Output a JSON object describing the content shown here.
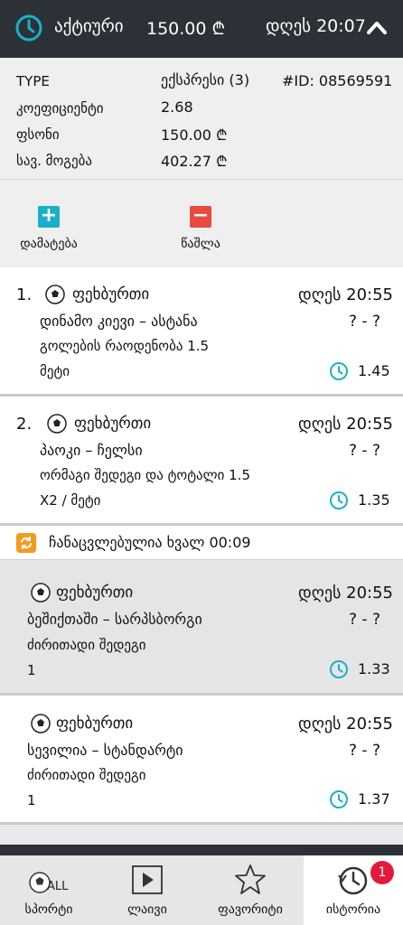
{
  "header": {
    "status": "აქტიური",
    "amount": "150.00 ₾",
    "time": "დღეს 20:07",
    "chevron_icon": "chevron-up-icon",
    "clock_icon": "clock-icon"
  },
  "summary": {
    "type_label": "TYPE",
    "type_value": "ექსპრესი (3)",
    "id": "#ID: 08569591",
    "coef_label": "კოეფიციენტი",
    "coef_value": "2.68",
    "stake_label": "ფსონი",
    "stake_value": "150.00 ₾",
    "win_label": "სავ. მოგება",
    "win_value": "402.27 ₾"
  },
  "actions": {
    "add_label": "დამატება",
    "delete_label": "წაშლა",
    "add_icon": "plus-icon",
    "delete_icon": "minus-icon"
  },
  "bets": [
    {
      "index": "1.",
      "sport": "ფეხბურთი",
      "time": "დღეს 20:55",
      "teams": "დინამო კიევი – ასტანა",
      "score": "? - ?",
      "market": "გოლების რაოდენობა 1.5",
      "pick": "მეტი",
      "odd": "1.45"
    },
    {
      "index": "2.",
      "sport": "ფეხბურთი",
      "time": "დღეს 20:55",
      "teams": "პაოკი – ჩელსი",
      "score": "? - ?",
      "market": "ორმაგი შედეგი და ტოტალი 1.5",
      "pick": "X2 / მეტი",
      "odd": "1.35"
    }
  ],
  "notice": {
    "text": "ჩანაცვლებულია ხვალ 00:09",
    "icon": "swap-icon"
  },
  "replaced": [
    {
      "sport": "ფეხბურთი",
      "time": "დღეს 20:55",
      "teams": "ბეშიქთაში – სარპსბორგი",
      "score": "? - ?",
      "market": "ძირითადი შედეგი",
      "pick": "1",
      "odd": "1.33"
    },
    {
      "sport": "ფეხბურთი",
      "time": "დღეს 20:55",
      "teams": "სევილია – სტანდარტი",
      "score": "? - ?",
      "market": "ძირითადი შედეგი",
      "pick": "1",
      "odd": "1.37"
    }
  ],
  "nav": {
    "sports": "სპორტი",
    "sports_icon_text": "ALL",
    "live": "ლაივი",
    "favorites": "ფავორიტი",
    "history": "ისტორია",
    "history_badge": "1"
  },
  "colors": {
    "header_bg": "#2c3137",
    "accent_teal": "#1ab0c9",
    "delete_red": "#e84a3f",
    "notice_orange": "#f29b1e",
    "badge_red": "#e3193d"
  }
}
